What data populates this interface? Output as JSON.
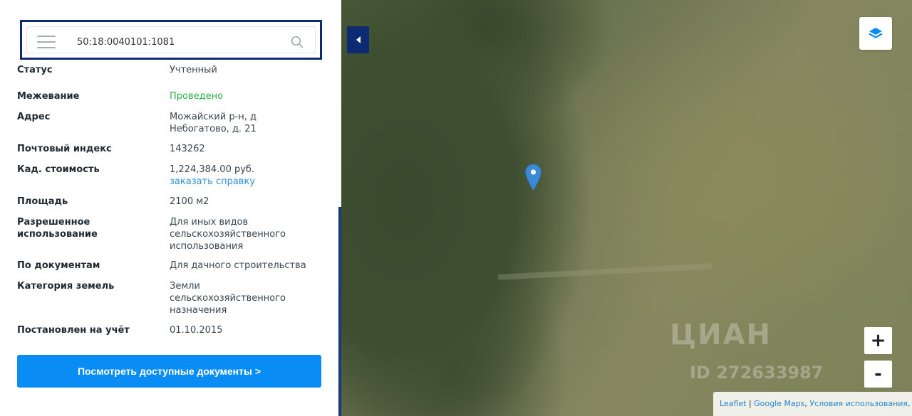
{
  "search": {
    "value": "50:18:0040101:1081"
  },
  "details": [
    {
      "label": "Статус",
      "value": "Учтенный"
    },
    {
      "label": "Межевание",
      "value": "Проведено"
    },
    {
      "label": "Адрес",
      "value": "Можайский р-н, д Небогатово, д. 21"
    },
    {
      "label": "Почтовый индекс",
      "value": "143262"
    },
    {
      "label": "Кад. стоимость",
      "value": "1,224,384.00 руб.",
      "link": "заказать справку"
    },
    {
      "label": "Площадь",
      "value": "2100 м2"
    },
    {
      "label": "Разрешенное использование",
      "value": "Для иных видов сельскохозяйственного использования"
    },
    {
      "label": "По документам",
      "value": "Для дачного строительства"
    },
    {
      "label": "Категория земель",
      "value": "Земли сельскохозяйственного назначения"
    },
    {
      "label": "Постановлен на учёт",
      "value": "01.10.2015"
    }
  ],
  "docs_button": "Посмотреть доступные документы >",
  "map": {
    "zoom_in": "+",
    "zoom_out": "-",
    "watermark_brand": "ЦИАН",
    "watermark_id": "ID 272633987",
    "attribution": {
      "leaflet": "Leaflet",
      "sep": " | ",
      "google": "Google Maps",
      "comma": ", ",
      "terms": "Условия использования, ©"
    }
  },
  "colors": {
    "accent": "#0a8cf5",
    "dark_blue": "#0d2a73",
    "green": "#2db14a",
    "link": "#2a8fd8"
  }
}
